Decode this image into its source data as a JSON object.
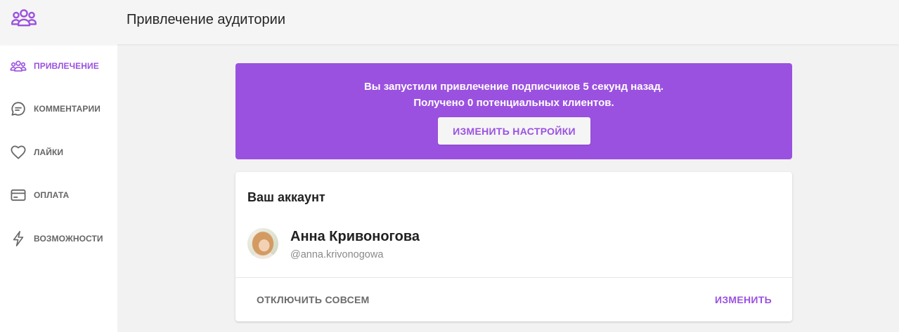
{
  "app": {
    "title": "Привлечение аудитории",
    "logo_icon": "users-group-icon"
  },
  "colors": {
    "accent": "#9b51e0",
    "header_bg": "#f5f5f5",
    "main_bg": "#f2f2f2",
    "sidebar_bg": "#ffffff",
    "card_bg": "#ffffff",
    "text_primary": "#212121",
    "text_secondary": "#666666",
    "button_bg": "#f5f5f5"
  },
  "sidebar": {
    "items": [
      {
        "label": "ПРИВЛЕЧЕНИЕ",
        "icon": "users-group-icon",
        "active": true
      },
      {
        "label": "КОММЕНТАРИИ",
        "icon": "comment-icon",
        "active": false
      },
      {
        "label": "ЛАЙКИ",
        "icon": "heart-icon",
        "active": false
      },
      {
        "label": "ОПЛАТА",
        "icon": "credit-card-icon",
        "active": false
      },
      {
        "label": "ВОЗМОЖНОСТИ",
        "icon": "lightning-icon",
        "active": false
      }
    ]
  },
  "banner": {
    "line1": "Вы запустили привлечение подписчиков 5 секунд назад.",
    "line2": "Получено 0 потенциальных клиентов.",
    "button_label": "ИЗМЕНИТЬ НАСТРОЙКИ"
  },
  "account_card": {
    "title": "Ваш аккаунт",
    "name": "Анна Кривоногова",
    "username": "@anna.krivonogowa",
    "disable_label": "ОТКЛЮЧИТЬ СОВСЕМ",
    "edit_label": "ИЗМЕНИТЬ"
  }
}
